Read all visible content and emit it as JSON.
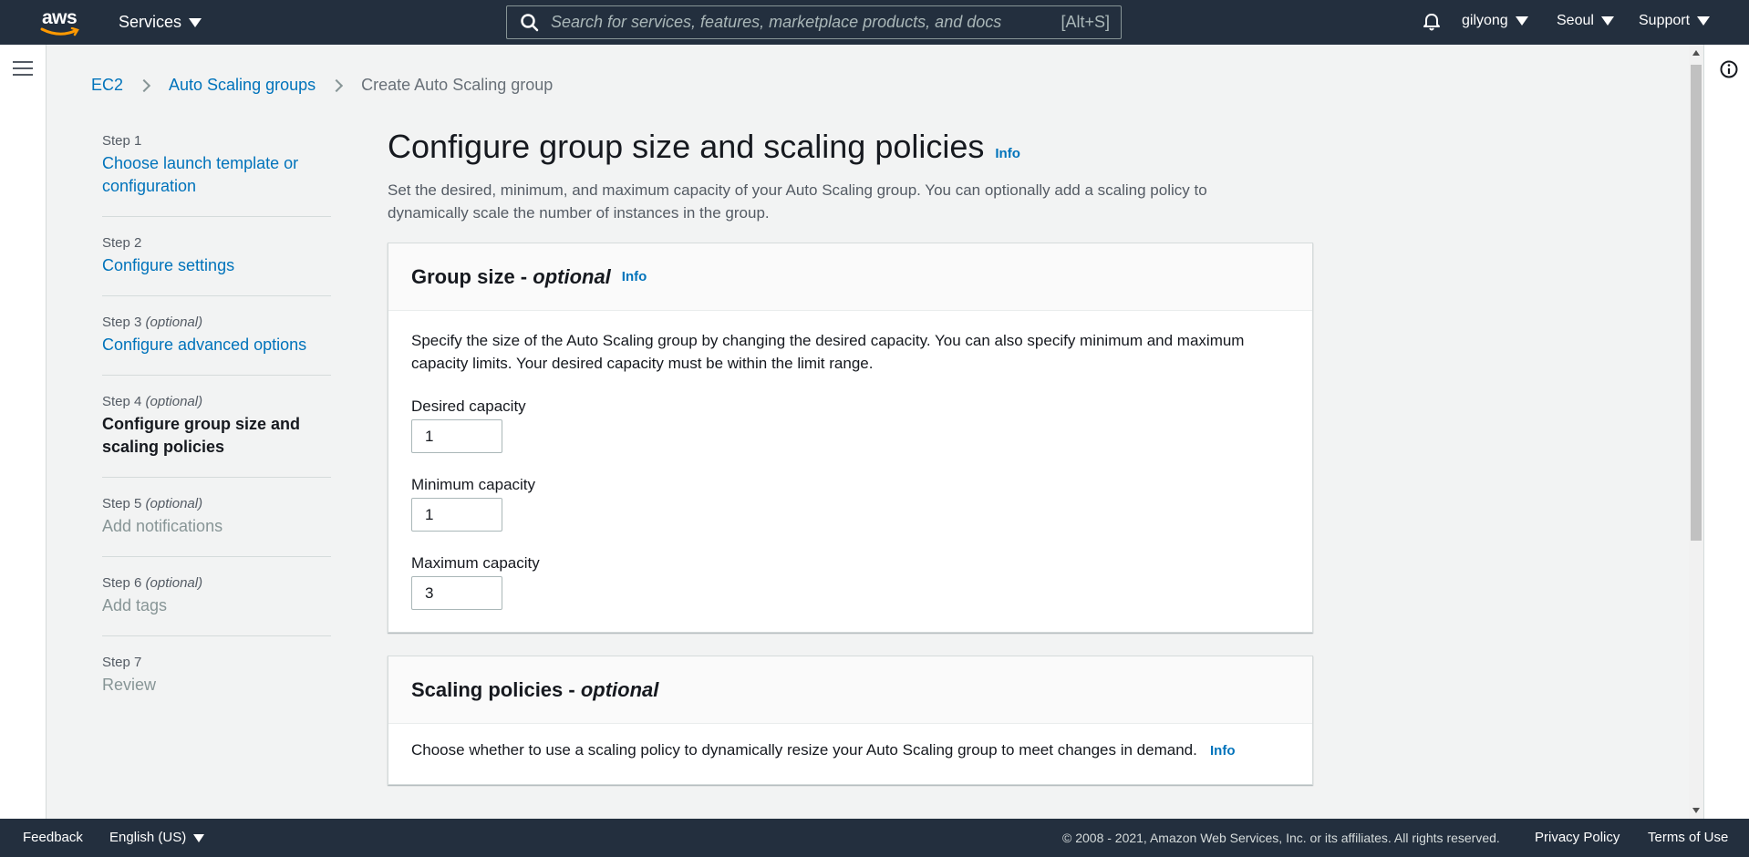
{
  "topnav": {
    "logo": "aws",
    "services_label": "Services",
    "search_placeholder": "Search for services, features, marketplace products, and docs",
    "search_shortcut": "[Alt+S]",
    "user": "gilyong",
    "region": "Seoul",
    "support": "Support"
  },
  "breadcrumb": {
    "items": [
      "EC2",
      "Auto Scaling groups"
    ],
    "current": "Create Auto Scaling group"
  },
  "steps": [
    {
      "num": "Step 1",
      "optional": "",
      "title": "Choose launch template or configuration",
      "state": "link"
    },
    {
      "num": "Step 2",
      "optional": "",
      "title": "Configure settings",
      "state": "link"
    },
    {
      "num": "Step 3",
      "optional": "(optional)",
      "title": "Configure advanced options",
      "state": "link"
    },
    {
      "num": "Step 4",
      "optional": "(optional)",
      "title": "Configure group size and scaling policies",
      "state": "active"
    },
    {
      "num": "Step 5",
      "optional": "(optional)",
      "title": "Add notifications",
      "state": "disabled"
    },
    {
      "num": "Step 6",
      "optional": "(optional)",
      "title": "Add tags",
      "state": "disabled"
    },
    {
      "num": "Step 7",
      "optional": "",
      "title": "Review",
      "state": "disabled"
    }
  ],
  "main": {
    "title": "Configure group size and scaling policies",
    "info": "Info",
    "description": "Set the desired, minimum, and maximum capacity of your Auto Scaling group. You can optionally add a scaling policy to dynamically scale the number of instances in the group.",
    "group_size": {
      "title": "Group size - ",
      "title_optional": "optional",
      "info": "Info",
      "text": "Specify the size of the Auto Scaling group by changing the desired capacity. You can also specify minimum and maximum capacity limits. Your desired capacity must be within the limit range.",
      "desired_label": "Desired capacity",
      "desired_value": "1",
      "min_label": "Minimum capacity",
      "min_value": "1",
      "max_label": "Maximum capacity",
      "max_value": "3"
    },
    "scaling_policies": {
      "title": "Scaling policies - ",
      "title_optional": "optional",
      "text": "Choose whether to use a scaling policy to dynamically resize your Auto Scaling group to meet changes in demand.",
      "info": "Info"
    }
  },
  "footer": {
    "feedback": "Feedback",
    "language": "English (US)",
    "copyright": "© 2008 - 2021, Amazon Web Services, Inc. or its affiliates. All rights reserved.",
    "privacy": "Privacy Policy",
    "terms": "Terms of Use"
  },
  "colors": {
    "nav_bg": "#232f3e",
    "link": "#0073bb",
    "aws_orange": "#ff9900"
  }
}
